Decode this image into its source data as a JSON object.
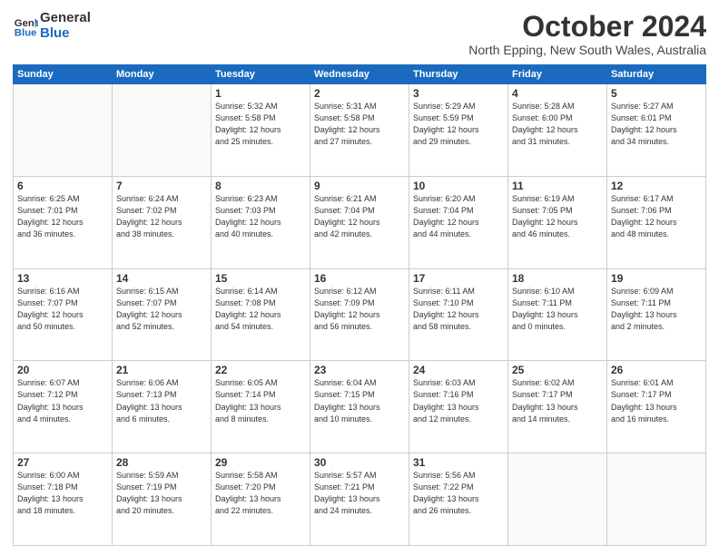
{
  "logo": {
    "general": "General",
    "blue": "Blue"
  },
  "title": "October 2024",
  "location": "North Epping, New South Wales, Australia",
  "days_header": [
    "Sunday",
    "Monday",
    "Tuesday",
    "Wednesday",
    "Thursday",
    "Friday",
    "Saturday"
  ],
  "weeks": [
    [
      {
        "day": "",
        "info": ""
      },
      {
        "day": "",
        "info": ""
      },
      {
        "day": "1",
        "info": "Sunrise: 5:32 AM\nSunset: 5:58 PM\nDaylight: 12 hours\nand 25 minutes."
      },
      {
        "day": "2",
        "info": "Sunrise: 5:31 AM\nSunset: 5:58 PM\nDaylight: 12 hours\nand 27 minutes."
      },
      {
        "day": "3",
        "info": "Sunrise: 5:29 AM\nSunset: 5:59 PM\nDaylight: 12 hours\nand 29 minutes."
      },
      {
        "day": "4",
        "info": "Sunrise: 5:28 AM\nSunset: 6:00 PM\nDaylight: 12 hours\nand 31 minutes."
      },
      {
        "day": "5",
        "info": "Sunrise: 5:27 AM\nSunset: 6:01 PM\nDaylight: 12 hours\nand 34 minutes."
      }
    ],
    [
      {
        "day": "6",
        "info": "Sunrise: 6:25 AM\nSunset: 7:01 PM\nDaylight: 12 hours\nand 36 minutes."
      },
      {
        "day": "7",
        "info": "Sunrise: 6:24 AM\nSunset: 7:02 PM\nDaylight: 12 hours\nand 38 minutes."
      },
      {
        "day": "8",
        "info": "Sunrise: 6:23 AM\nSunset: 7:03 PM\nDaylight: 12 hours\nand 40 minutes."
      },
      {
        "day": "9",
        "info": "Sunrise: 6:21 AM\nSunset: 7:04 PM\nDaylight: 12 hours\nand 42 minutes."
      },
      {
        "day": "10",
        "info": "Sunrise: 6:20 AM\nSunset: 7:04 PM\nDaylight: 12 hours\nand 44 minutes."
      },
      {
        "day": "11",
        "info": "Sunrise: 6:19 AM\nSunset: 7:05 PM\nDaylight: 12 hours\nand 46 minutes."
      },
      {
        "day": "12",
        "info": "Sunrise: 6:17 AM\nSunset: 7:06 PM\nDaylight: 12 hours\nand 48 minutes."
      }
    ],
    [
      {
        "day": "13",
        "info": "Sunrise: 6:16 AM\nSunset: 7:07 PM\nDaylight: 12 hours\nand 50 minutes."
      },
      {
        "day": "14",
        "info": "Sunrise: 6:15 AM\nSunset: 7:07 PM\nDaylight: 12 hours\nand 52 minutes."
      },
      {
        "day": "15",
        "info": "Sunrise: 6:14 AM\nSunset: 7:08 PM\nDaylight: 12 hours\nand 54 minutes."
      },
      {
        "day": "16",
        "info": "Sunrise: 6:12 AM\nSunset: 7:09 PM\nDaylight: 12 hours\nand 56 minutes."
      },
      {
        "day": "17",
        "info": "Sunrise: 6:11 AM\nSunset: 7:10 PM\nDaylight: 12 hours\nand 58 minutes."
      },
      {
        "day": "18",
        "info": "Sunrise: 6:10 AM\nSunset: 7:11 PM\nDaylight: 13 hours\nand 0 minutes."
      },
      {
        "day": "19",
        "info": "Sunrise: 6:09 AM\nSunset: 7:11 PM\nDaylight: 13 hours\nand 2 minutes."
      }
    ],
    [
      {
        "day": "20",
        "info": "Sunrise: 6:07 AM\nSunset: 7:12 PM\nDaylight: 13 hours\nand 4 minutes."
      },
      {
        "day": "21",
        "info": "Sunrise: 6:06 AM\nSunset: 7:13 PM\nDaylight: 13 hours\nand 6 minutes."
      },
      {
        "day": "22",
        "info": "Sunrise: 6:05 AM\nSunset: 7:14 PM\nDaylight: 13 hours\nand 8 minutes."
      },
      {
        "day": "23",
        "info": "Sunrise: 6:04 AM\nSunset: 7:15 PM\nDaylight: 13 hours\nand 10 minutes."
      },
      {
        "day": "24",
        "info": "Sunrise: 6:03 AM\nSunset: 7:16 PM\nDaylight: 13 hours\nand 12 minutes."
      },
      {
        "day": "25",
        "info": "Sunrise: 6:02 AM\nSunset: 7:17 PM\nDaylight: 13 hours\nand 14 minutes."
      },
      {
        "day": "26",
        "info": "Sunrise: 6:01 AM\nSunset: 7:17 PM\nDaylight: 13 hours\nand 16 minutes."
      }
    ],
    [
      {
        "day": "27",
        "info": "Sunrise: 6:00 AM\nSunset: 7:18 PM\nDaylight: 13 hours\nand 18 minutes."
      },
      {
        "day": "28",
        "info": "Sunrise: 5:59 AM\nSunset: 7:19 PM\nDaylight: 13 hours\nand 20 minutes."
      },
      {
        "day": "29",
        "info": "Sunrise: 5:58 AM\nSunset: 7:20 PM\nDaylight: 13 hours\nand 22 minutes."
      },
      {
        "day": "30",
        "info": "Sunrise: 5:57 AM\nSunset: 7:21 PM\nDaylight: 13 hours\nand 24 minutes."
      },
      {
        "day": "31",
        "info": "Sunrise: 5:56 AM\nSunset: 7:22 PM\nDaylight: 13 hours\nand 26 minutes."
      },
      {
        "day": "",
        "info": ""
      },
      {
        "day": "",
        "info": ""
      }
    ]
  ]
}
